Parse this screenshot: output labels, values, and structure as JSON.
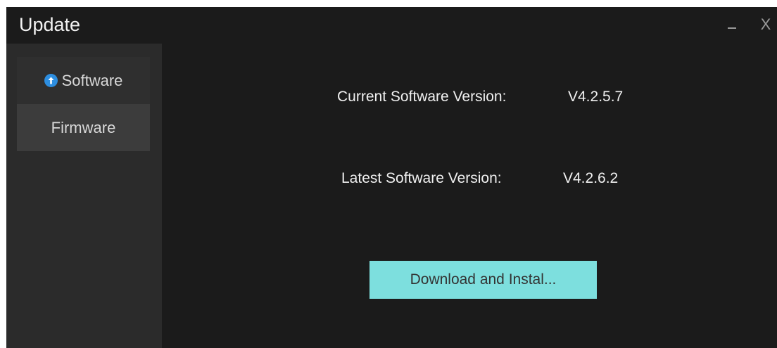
{
  "window": {
    "title": "Update",
    "minimize_icon": "minimize-icon",
    "close_label": "X"
  },
  "sidebar": {
    "items": [
      {
        "label": "Software",
        "icon": "arrow-up-circle-icon",
        "active": true
      },
      {
        "label": "Firmware",
        "active": false
      }
    ]
  },
  "main": {
    "current_label": "Current Software Version:",
    "current_value": "V4.2.5.7",
    "latest_label": "Latest Software Version:",
    "latest_value": "V4.2.6.2",
    "download_button": "Download and Instal..."
  },
  "colors": {
    "background": "#1b1b1b",
    "sidebar": "#2b2b2b",
    "firmware_tab": "#3c3c3c",
    "accent_button": "#7ddfde",
    "icon_blue": "#2d8ee0"
  }
}
